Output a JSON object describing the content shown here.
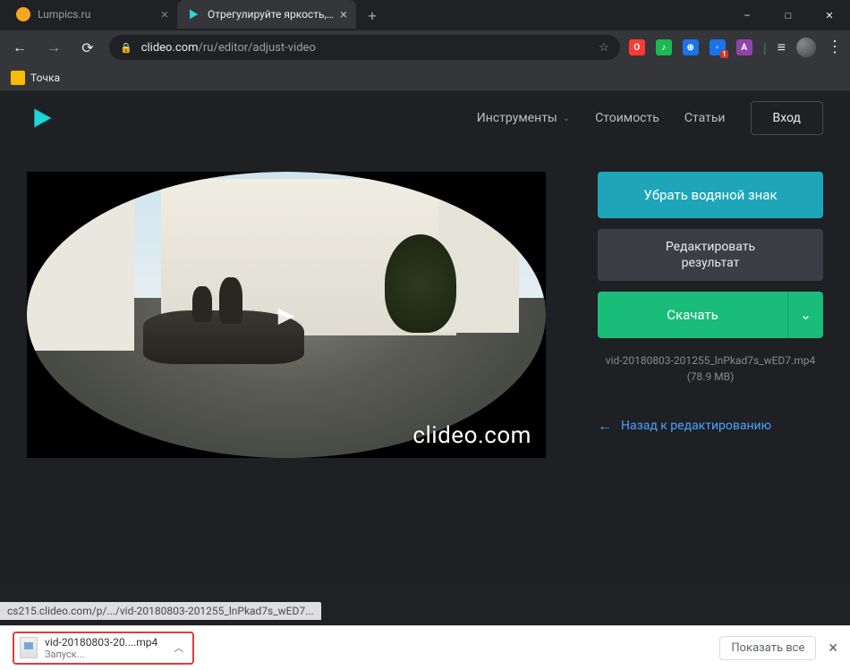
{
  "window": {
    "minimize": "–",
    "maximize": "□",
    "close": "✕"
  },
  "tabs": [
    {
      "title": "Lumpics.ru",
      "favicon_bg": "#f5a623"
    },
    {
      "title": "Отрегулируйте яркость, контра"
    }
  ],
  "toolbar": {
    "back": "←",
    "forward": "→",
    "reload": "⟳",
    "url_host": "clideo.com",
    "url_path": "/ru/editor/adjust-video",
    "star": "☆"
  },
  "extensions": [
    {
      "bg": "#ff3b30",
      "fg": "#fff",
      "glyph": "O"
    },
    {
      "bg": "#1db954",
      "fg": "#fff",
      "glyph": "♪"
    },
    {
      "bg": "#1a73e8",
      "fg": "#fff",
      "glyph": "⊕"
    },
    {
      "bg": "#1a73e8",
      "fg": "#fff",
      "glyph": "🗂"
    },
    {
      "bg": "#8e44ad",
      "fg": "#fff",
      "glyph": "A"
    }
  ],
  "readlist_glyph": "≡",
  "bookmarks": [
    {
      "label": "Точка"
    }
  ],
  "page": {
    "nav": {
      "tools": "Инструменты",
      "pricing": "Стоимость",
      "articles": "Статьи",
      "login": "Вход"
    },
    "watermark": "clideo.com",
    "buttons": {
      "remove_watermark": "Убрать водяной знак",
      "edit_result_l1": "Редактировать",
      "edit_result_l2": "результат",
      "download": "Скачать"
    },
    "file": {
      "name": "vid-20180803-201255_lnPkad7s_wED7.mp4",
      "size": "(78.9 MB)"
    },
    "back_link": "Назад к редактированию"
  },
  "status_bar": "cs215.clideo.com/p/.../vid-20180803-201255_lnPkad7s_wED7...",
  "downloads": {
    "item": {
      "name": "vid-20180803-20....mp4",
      "status": "Запуск..."
    },
    "show_all": "Показать все"
  }
}
